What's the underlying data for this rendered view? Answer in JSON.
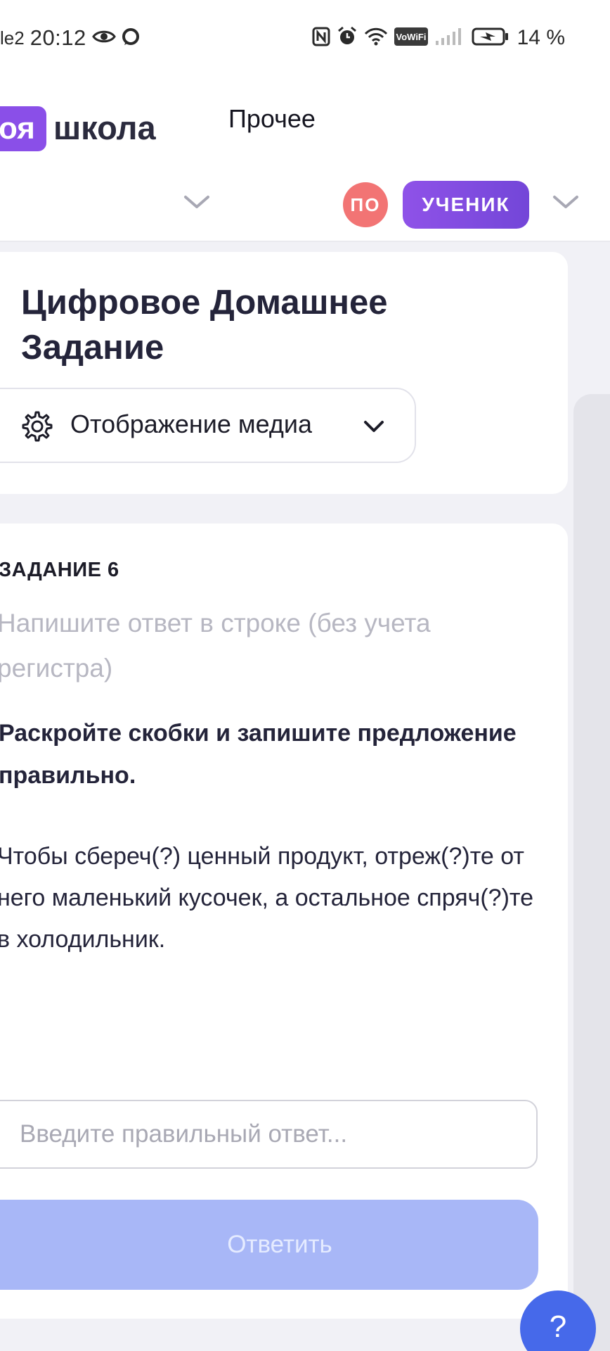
{
  "status_bar": {
    "carrier": "le2",
    "time": "20:12",
    "battery": "14 %",
    "icons": [
      "eye-icon",
      "chat-icon",
      "nfc-icon",
      "alarm-icon",
      "wifi-icon",
      "vowifi-icon",
      "signal-icon",
      "battery-icon"
    ],
    "vowifi_label": "VoWiFi"
  },
  "header": {
    "title": "Прочее",
    "logo_badge": "оя",
    "school_label": "школа",
    "avatar_initials": "ПО",
    "role": "УЧЕНИК"
  },
  "homework": {
    "title": "Цифровое Домашнее Задание",
    "media_display_label": "Отображение медиа"
  },
  "task": {
    "number_label": "ЗАДАНИЕ 6",
    "hint": "Напишите ответ в строке (без учета регистра)",
    "question": "Раскройте скобки и запишите предложение правильно.",
    "text": "Чтобы сбереч(?) ценный продукт, отреж(?)те от него маленький кусочек, а остальное спряч(?)те в холодильник.",
    "answer_placeholder": "Введите правильный ответ...",
    "answer_value": "",
    "submit_label": "Ответить"
  },
  "help": {
    "label": "?"
  },
  "colors": {
    "accent_purple": "#8a4fe8",
    "avatar_red": "#f27474",
    "submit_disabled": "#a8b7f7",
    "help_blue": "#4669ea"
  }
}
